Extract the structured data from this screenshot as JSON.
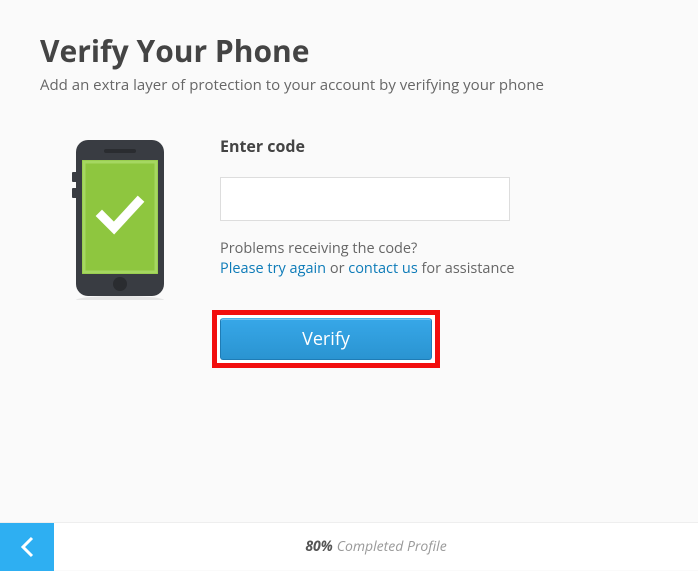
{
  "title": "Verify Your Phone",
  "subtitle": "Add an extra layer of protection to your account by verifying your phone",
  "form": {
    "label": "Enter code",
    "value": "",
    "placeholder": ""
  },
  "help": {
    "problems_text": "Problems receiving the code?",
    "try_again": "Please try again",
    "or_text": " or ",
    "contact_us": "contact us",
    "suffix": " for assistance"
  },
  "button": {
    "verify": "Verify"
  },
  "footer": {
    "percent": "80%",
    "label": "Completed Profile"
  }
}
